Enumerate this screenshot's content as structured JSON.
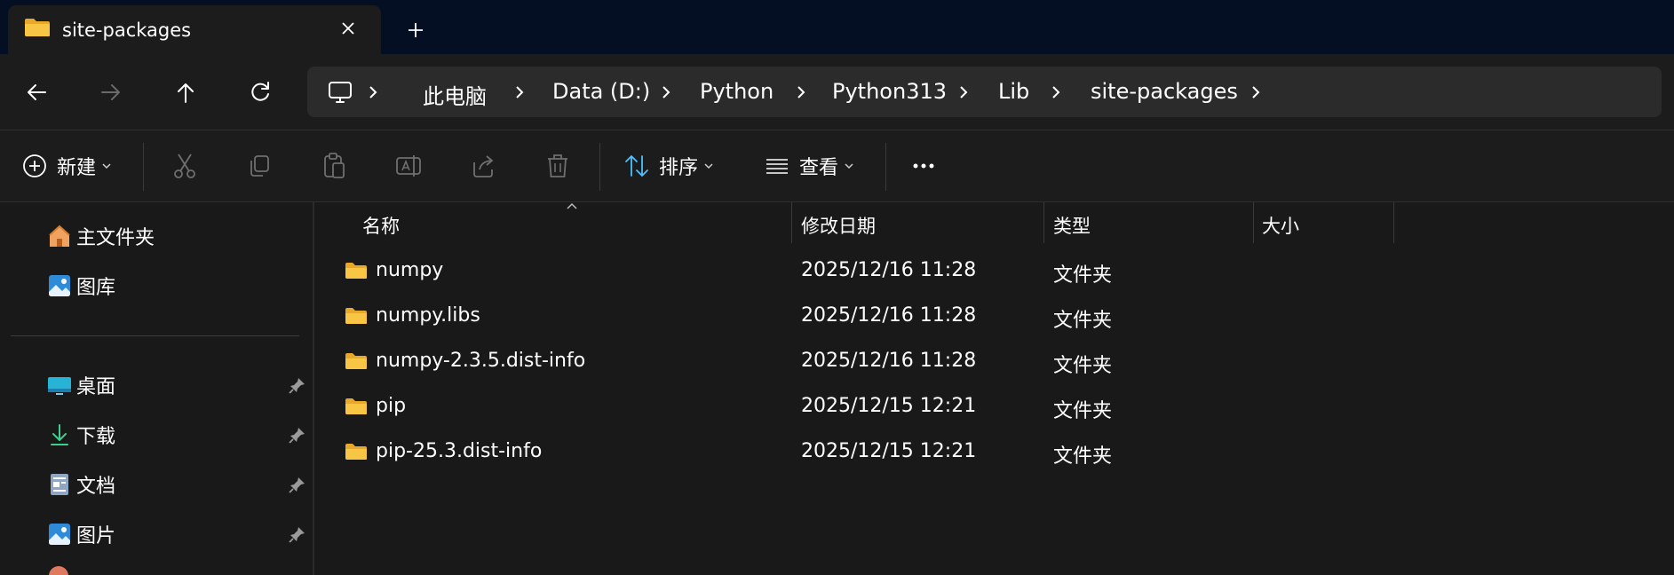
{
  "tab": {
    "title": "site-packages",
    "icon": "folder-icon"
  },
  "nav": {
    "back": "arrow-left-icon",
    "forward": "arrow-right-icon",
    "up": "arrow-up-icon",
    "refresh": "refresh-icon"
  },
  "breadcrumb": [
    "此电脑",
    "Data (D:)",
    "Python",
    "Python313",
    "Lib",
    "site-packages"
  ],
  "commands": {
    "new_label": "新建",
    "sort_label": "排序",
    "view_label": "查看",
    "more": "…"
  },
  "sidebar": {
    "top_items": [
      {
        "label": "主文件夹",
        "icon": "home-icon"
      },
      {
        "label": "图库",
        "icon": "gallery-icon"
      }
    ],
    "pinned_items": [
      {
        "label": "桌面",
        "icon": "desktop-icon"
      },
      {
        "label": "下载",
        "icon": "download-icon"
      },
      {
        "label": "文档",
        "icon": "document-icon"
      },
      {
        "label": "图片",
        "icon": "pictures-icon"
      }
    ]
  },
  "columns": [
    "名称",
    "修改日期",
    "类型",
    "大小"
  ],
  "files": [
    {
      "name": "numpy",
      "date": "2025/12/16 11:28",
      "type": "文件夹",
      "size": ""
    },
    {
      "name": "numpy.libs",
      "date": "2025/12/16 11:28",
      "type": "文件夹",
      "size": ""
    },
    {
      "name": "numpy-2.3.5.dist-info",
      "date": "2025/12/16 11:28",
      "type": "文件夹",
      "size": ""
    },
    {
      "name": "pip",
      "date": "2025/12/15 12:21",
      "type": "文件夹",
      "size": ""
    },
    {
      "name": "pip-25.3.dist-info",
      "date": "2025/12/15 12:21",
      "type": "文件夹",
      "size": ""
    }
  ],
  "colors": {
    "titlebar": "#050f24",
    "folder": "#f8c545",
    "background": "#191919",
    "accent": "#4cc2ff"
  }
}
